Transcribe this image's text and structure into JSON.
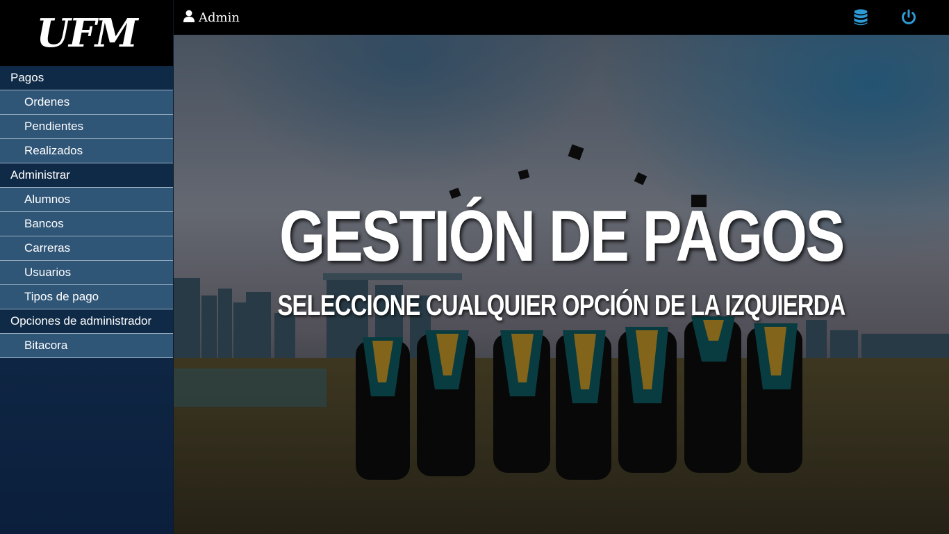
{
  "brand": {
    "logo_text": "UFM"
  },
  "topbar": {
    "user_label": "Admin",
    "icons": [
      "user-icon",
      "database-icon",
      "power-icon"
    ],
    "icon_color": "#2d9bd6"
  },
  "sidebar": {
    "sections": [
      {
        "label": "Pagos",
        "items": [
          "Ordenes",
          "Pendientes",
          "Realizados"
        ]
      },
      {
        "label": "Administrar",
        "items": [
          "Alumnos",
          "Bancos",
          "Carreras",
          "Usuarios",
          "Tipos de pago"
        ]
      },
      {
        "label": "Opciones de administrador",
        "items": [
          "Bitacora"
        ]
      }
    ]
  },
  "hero": {
    "title": "GESTIÓN DE PAGOS",
    "subtitle": "SELECCIONE CUALQUIER OPCIÓN DE LA IZQUIERDA",
    "background": "graduates throwing caps"
  },
  "colors": {
    "sidebar_section_bg": "#0f2a47",
    "sidebar_item_bg": "#2f5577",
    "topbar_bg": "#000000"
  }
}
